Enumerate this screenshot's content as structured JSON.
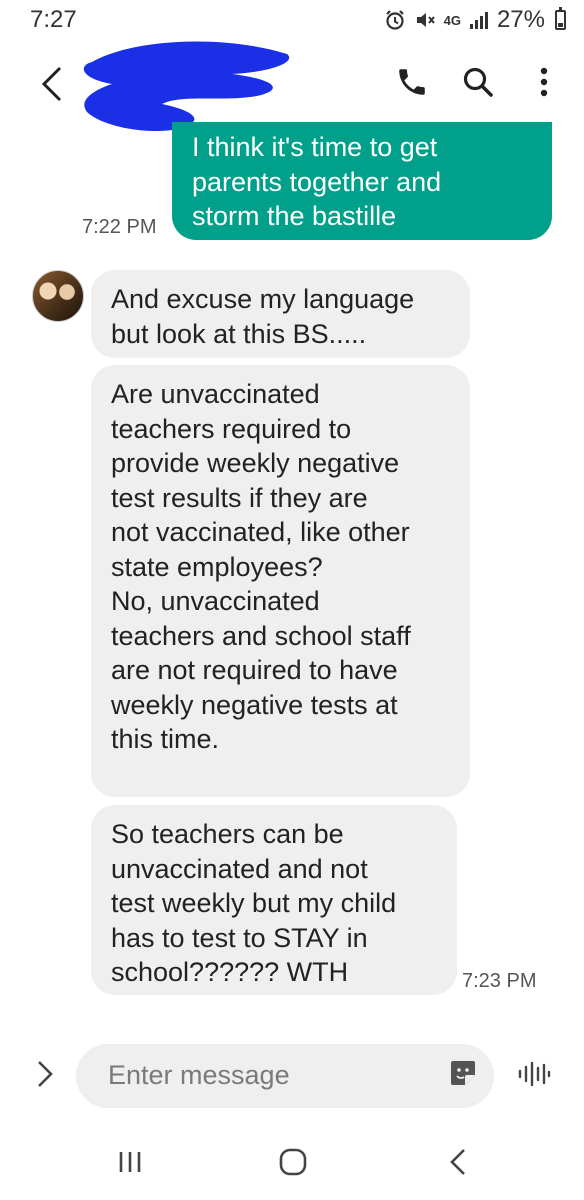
{
  "status_bar": {
    "time": "7:27",
    "network": "4G",
    "battery": "27%",
    "battery_level_percent": 27
  },
  "header": {
    "contact_name_redacted": true,
    "icons": [
      "back-arrow-icon",
      "phone-icon",
      "search-icon",
      "more-vertical-icon"
    ]
  },
  "messages": [
    {
      "direction": "sent",
      "lines": [
        "I think it's time to get",
        "parents together and",
        "storm the bastille"
      ],
      "time": "7:22 PM"
    },
    {
      "direction": "received",
      "lines": [
        "And excuse my language",
        "but look at this BS....."
      ]
    },
    {
      "direction": "received",
      "lines": [
        "Are unvaccinated",
        "teachers required to",
        "provide weekly negative",
        "test results if they are",
        "not vaccinated, like other",
        "state employees?",
        "No, unvaccinated",
        "teachers and school staff",
        "are not required to have",
        "weekly negative tests at",
        "this time."
      ]
    },
    {
      "direction": "received",
      "lines": [
        "So teachers can be",
        "unvaccinated and not",
        "test weekly but my child",
        "has to test to STAY in",
        "school?????? WTH"
      ],
      "time": "7:23 PM"
    }
  ],
  "composer": {
    "placeholder": "Enter message",
    "icons": [
      "expand-chevron-icon",
      "sticker-icon",
      "voice-waveform-icon"
    ]
  },
  "nav": {
    "icons": [
      "recent-apps-icon",
      "home-icon",
      "back-icon"
    ]
  },
  "colors": {
    "sent_bubble": "#00a08a",
    "received_bubble": "#efefef",
    "redaction": "#1a2fe6"
  }
}
